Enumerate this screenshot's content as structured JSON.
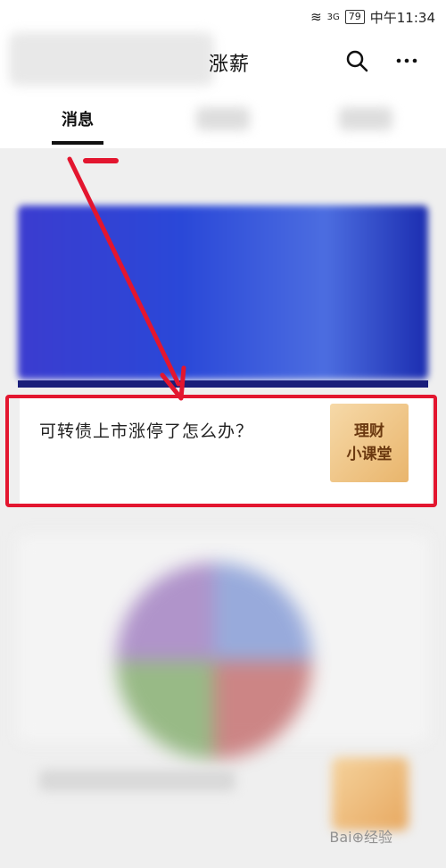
{
  "status_bar": {
    "signal": "3G",
    "battery": "79",
    "time": "中午11:34"
  },
  "header": {
    "title_visible": "涨薪",
    "icons": [
      "search-icon",
      "more-icon"
    ]
  },
  "tabs": [
    {
      "label": "消息",
      "active": true
    }
  ],
  "article": {
    "title": "可转债上市涨停了怎么办？",
    "thumbnail_text": [
      "理财",
      "小课堂"
    ]
  },
  "annotation": {
    "highlight_color": "#e3162f"
  },
  "watermark": "Bai⊕经验"
}
